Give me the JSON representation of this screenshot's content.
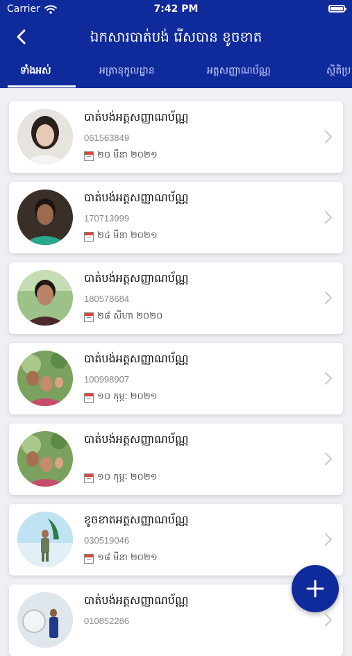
{
  "status_bar": {
    "carrier": "Carrier",
    "time": "7:42 PM"
  },
  "nav": {
    "title": "ឯកសារបាត់បង់ រើសបាន ខូចខាត"
  },
  "tabs": [
    {
      "label": "ទាំងអស់"
    },
    {
      "label": "អត្រានុកូលដ្ឋាន"
    },
    {
      "label": "អត្តសញ្ញាណប័ណ្ណ"
    },
    {
      "label": "ស្ថិតិប្រ"
    }
  ],
  "cards": [
    {
      "title": "បាត់បង់អត្តសញ្ញាណប័ណ្ណ",
      "number": "061563849",
      "date": "២០ មីនា ២០២១"
    },
    {
      "title": "បាត់បង់អត្តសញ្ញាណប័ណ្ណ",
      "number": "170713999",
      "date": "២៤ មីនា ២០២១"
    },
    {
      "title": "បាត់បង់អត្តសញ្ញាណប័ណ្ណ",
      "number": "180578684",
      "date": "២៨ សីហា ២០២០"
    },
    {
      "title": "បាត់បង់អត្តសញ្ញាណប័ណ្ណ",
      "number": "100998907",
      "date": "១០ កុម្ភៈ ២០២១"
    },
    {
      "title": "បាត់បង់អត្តសញ្ញាណប័ណ្ណ",
      "number": "",
      "date": "១០ កុម្ភៈ ២០២១"
    },
    {
      "title": "ខូចខាតអត្តសញ្ញាណប័ណ្ណ",
      "number": "030519046",
      "date": "១៨ មីនា ២០២១"
    },
    {
      "title": "បាត់បង់អត្តសញ្ញាណប័ណ្ណ",
      "number": "010852286",
      "date": ""
    }
  ],
  "colors": {
    "primary": "#0f2a9a",
    "background": "#eef0f4"
  },
  "icons": {
    "back": "chevron-left-icon",
    "add": "plus-icon",
    "row_chevron": "chevron-right-icon",
    "calendar": "calendar-icon"
  }
}
